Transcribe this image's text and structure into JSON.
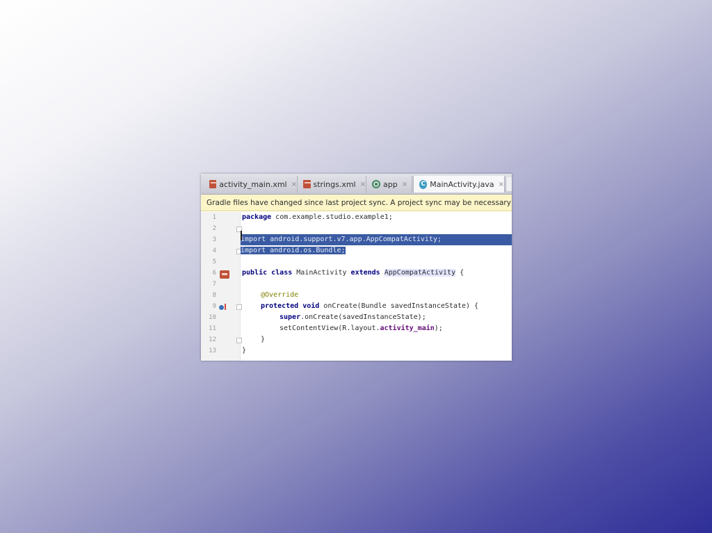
{
  "tabs": [
    {
      "label": "activity_main.xml",
      "icon": "xml-file-icon",
      "close": "×"
    },
    {
      "label": "strings.xml",
      "icon": "xml-file-icon",
      "close": "×"
    },
    {
      "label": "app",
      "icon": "gradle-icon",
      "close": "×"
    },
    {
      "label": "MainActivity.java",
      "icon": "java-class-icon",
      "icon_letter": "C",
      "close": "×",
      "active": true
    }
  ],
  "banner": {
    "text": "Gradle files have changed since last project sync. A project sync may be necessary for th"
  },
  "editor": {
    "line_numbers": [
      "1",
      "2",
      "3",
      "4",
      "5",
      "6",
      "7",
      "8",
      "9",
      "10",
      "11",
      "12",
      "13"
    ],
    "lines": {
      "l1_kw": "package",
      "l1_rest": " com.example.studio.example1;",
      "l3": "import android.support.v7.app.AppCompatActivity;",
      "l4": "import android.os.Bundle;",
      "l6_kw1": "public class",
      "l6_mid": " MainActivity ",
      "l6_kw2": "extends",
      "l6_sp": " ",
      "l6_hl": "AppCompatActivity",
      "l6_end": " {",
      "l8": "@Override",
      "l9_kw": "protected void",
      "l9_rest": " onCreate(Bundle savedInstanceState) {",
      "l10_kw": "super",
      "l10_rest": ".onCreate(savedInstanceState);",
      "l11_a": "setContentView(R.layout.",
      "l11_fld": "activity_main",
      "l11_b": ");",
      "l12": "}",
      "l13": "}"
    }
  },
  "colors": {
    "selection": "#3a5ba3",
    "keyword": "#000080",
    "annotation": "#808000",
    "banner_bg": "#fbf5c8"
  }
}
